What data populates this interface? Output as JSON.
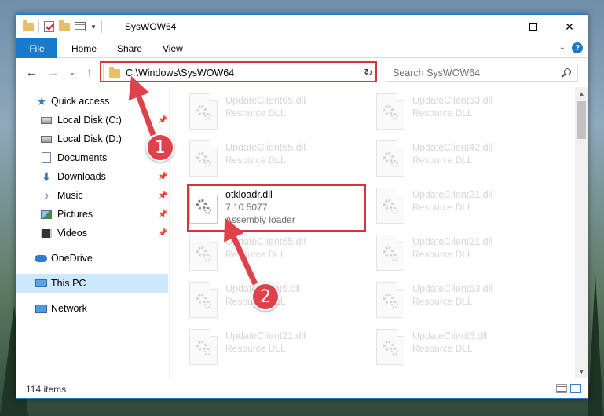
{
  "window": {
    "title": "SysWOW64",
    "controls": {
      "minimize": "minimize-icon",
      "maximize": "maximize-icon",
      "close": "close-icon"
    }
  },
  "ribbon": {
    "tabs": [
      {
        "label": "File"
      },
      {
        "label": "Home"
      },
      {
        "label": "Share"
      },
      {
        "label": "View"
      }
    ],
    "help": "?"
  },
  "navigation": {
    "address": "C:\\Windows\\SysWOW64",
    "search_placeholder": "Search SysWOW64"
  },
  "sidebar": {
    "items": [
      {
        "label": "Quick access",
        "icon": "star-icon",
        "pinned": false
      },
      {
        "label": "Local Disk (C:)",
        "icon": "disk-icon",
        "pinned": true
      },
      {
        "label": "Local Disk (D:)",
        "icon": "disk-icon",
        "pinned": false
      },
      {
        "label": "Documents",
        "icon": "documents-icon",
        "pinned": true
      },
      {
        "label": "Downloads",
        "icon": "downloads-icon",
        "pinned": true
      },
      {
        "label": "Music",
        "icon": "music-icon",
        "pinned": true
      },
      {
        "label": "Pictures",
        "icon": "pictures-icon",
        "pinned": true
      },
      {
        "label": "Videos",
        "icon": "videos-icon",
        "pinned": true
      },
      {
        "label": "OneDrive",
        "icon": "onedrive-icon",
        "pinned": false
      },
      {
        "label": "This PC",
        "icon": "this-pc-icon",
        "pinned": false,
        "selected": true
      },
      {
        "label": "Network",
        "icon": "network-icon",
        "pinned": false
      }
    ]
  },
  "files": [
    {
      "name": "UpdateClient65.dll",
      "type": "Resource DLL"
    },
    {
      "name": "UpdateClient63.dll",
      "type": "Resource DLL"
    },
    {
      "name": "UpdateClient65.dll",
      "type": "Resource DLL"
    },
    {
      "name": "UpdateClient42.dll",
      "type": "Resource DLL"
    },
    {
      "name": "otkloadr.dll",
      "version": "7.10.5077",
      "type": "Assembly loader",
      "highlighted": true
    },
    {
      "name": "UpdateClient21.dll",
      "type": "Resource DLL"
    },
    {
      "name": "UpdateClient65.dll",
      "type": "Resource DLL"
    },
    {
      "name": "UpdateClient21.dll",
      "type": "Resource DLL"
    },
    {
      "name": "UpdateClient5.dll",
      "type": "Resource DLL"
    },
    {
      "name": "UpdateClient63.dll",
      "type": "Resource DLL"
    },
    {
      "name": "UpdateClient21.dll",
      "type": "Resource DLL"
    },
    {
      "name": "UpdateClient5.dll",
      "type": "Resource DLL"
    }
  ],
  "status": {
    "item_count": "114 items"
  },
  "annotations": {
    "marker_1": "1",
    "marker_2": "2",
    "color": "#d8323c"
  },
  "colors": {
    "accent": "#1979ca",
    "selection": "#cce8ff"
  }
}
